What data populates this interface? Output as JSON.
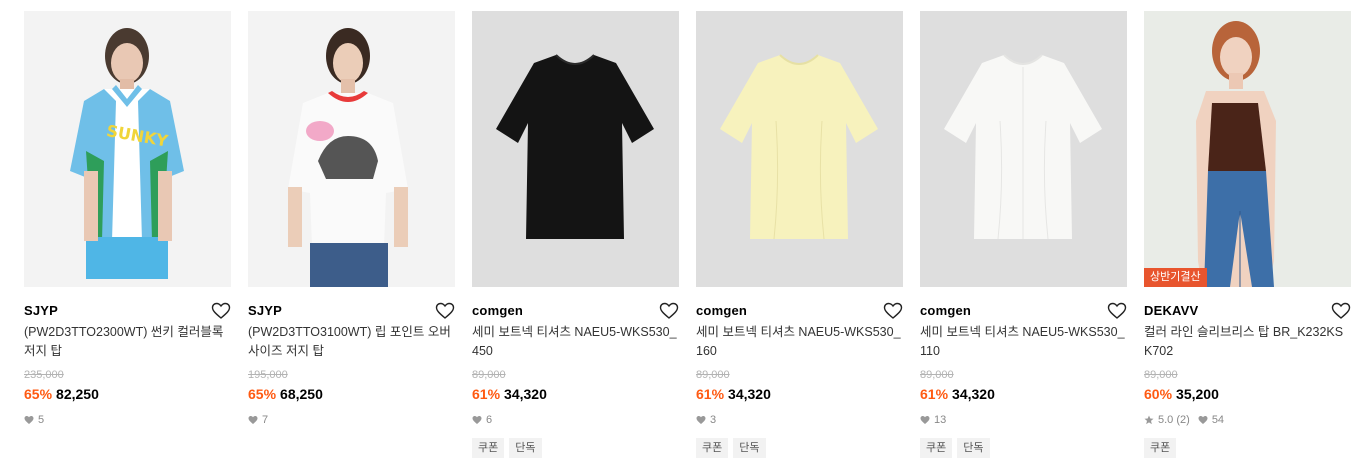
{
  "products": [
    {
      "brand": "SJYP",
      "name": "(PW2D3TTO2300WT) 썬키 컬러블록 저지 탑",
      "original_price": "235,000",
      "discount": "65%",
      "price": "82,250",
      "likes": "5",
      "rating": null,
      "tags": [],
      "badge": null,
      "image": "model-blue-jersey-photo"
    },
    {
      "brand": "SJYP",
      "name": "(PW2D3TTO3100WT) 립 포인트 오버사이즈 저지 탑",
      "original_price": "195,000",
      "discount": "65%",
      "price": "68,250",
      "likes": "7",
      "rating": null,
      "tags": [],
      "badge": null,
      "image": "model-white-tee-photo"
    },
    {
      "brand": "comgen",
      "name": "세미 보트넥 티셔츠 NAEU5-WKS530_450",
      "original_price": "89,000",
      "discount": "61%",
      "price": "34,320",
      "likes": "6",
      "rating": null,
      "tags": [
        "쿠폰",
        "단독"
      ],
      "badge": null,
      "image": "black-tee-photo"
    },
    {
      "brand": "comgen",
      "name": "세미 보트넥 티셔츠 NAEU5-WKS530_160",
      "original_price": "89,000",
      "discount": "61%",
      "price": "34,320",
      "likes": "3",
      "rating": null,
      "tags": [
        "쿠폰",
        "단독"
      ],
      "badge": null,
      "image": "yellow-tee-photo"
    },
    {
      "brand": "comgen",
      "name": "세미 보트넥 티셔츠 NAEU5-WKS530_110",
      "original_price": "89,000",
      "discount": "61%",
      "price": "34,320",
      "likes": "13",
      "rating": null,
      "tags": [
        "쿠폰",
        "단독"
      ],
      "badge": null,
      "image": "white-tee-photo"
    },
    {
      "brand": "DEKAVV",
      "name": "컬러 라인 슬리브리스 탑 BR_K232KSK702",
      "original_price": "89,000",
      "discount": "60%",
      "price": "35,200",
      "likes": "54",
      "rating": "5.0",
      "rating_count": "(2)",
      "tags": [
        "쿠폰"
      ],
      "badge": "상반기결산",
      "image": "model-sleeveless-photo"
    }
  ],
  "colors": {
    "discount": "#ff5a12",
    "badge": "#e8552e",
    "tag_bg": "#f2f2f2"
  }
}
